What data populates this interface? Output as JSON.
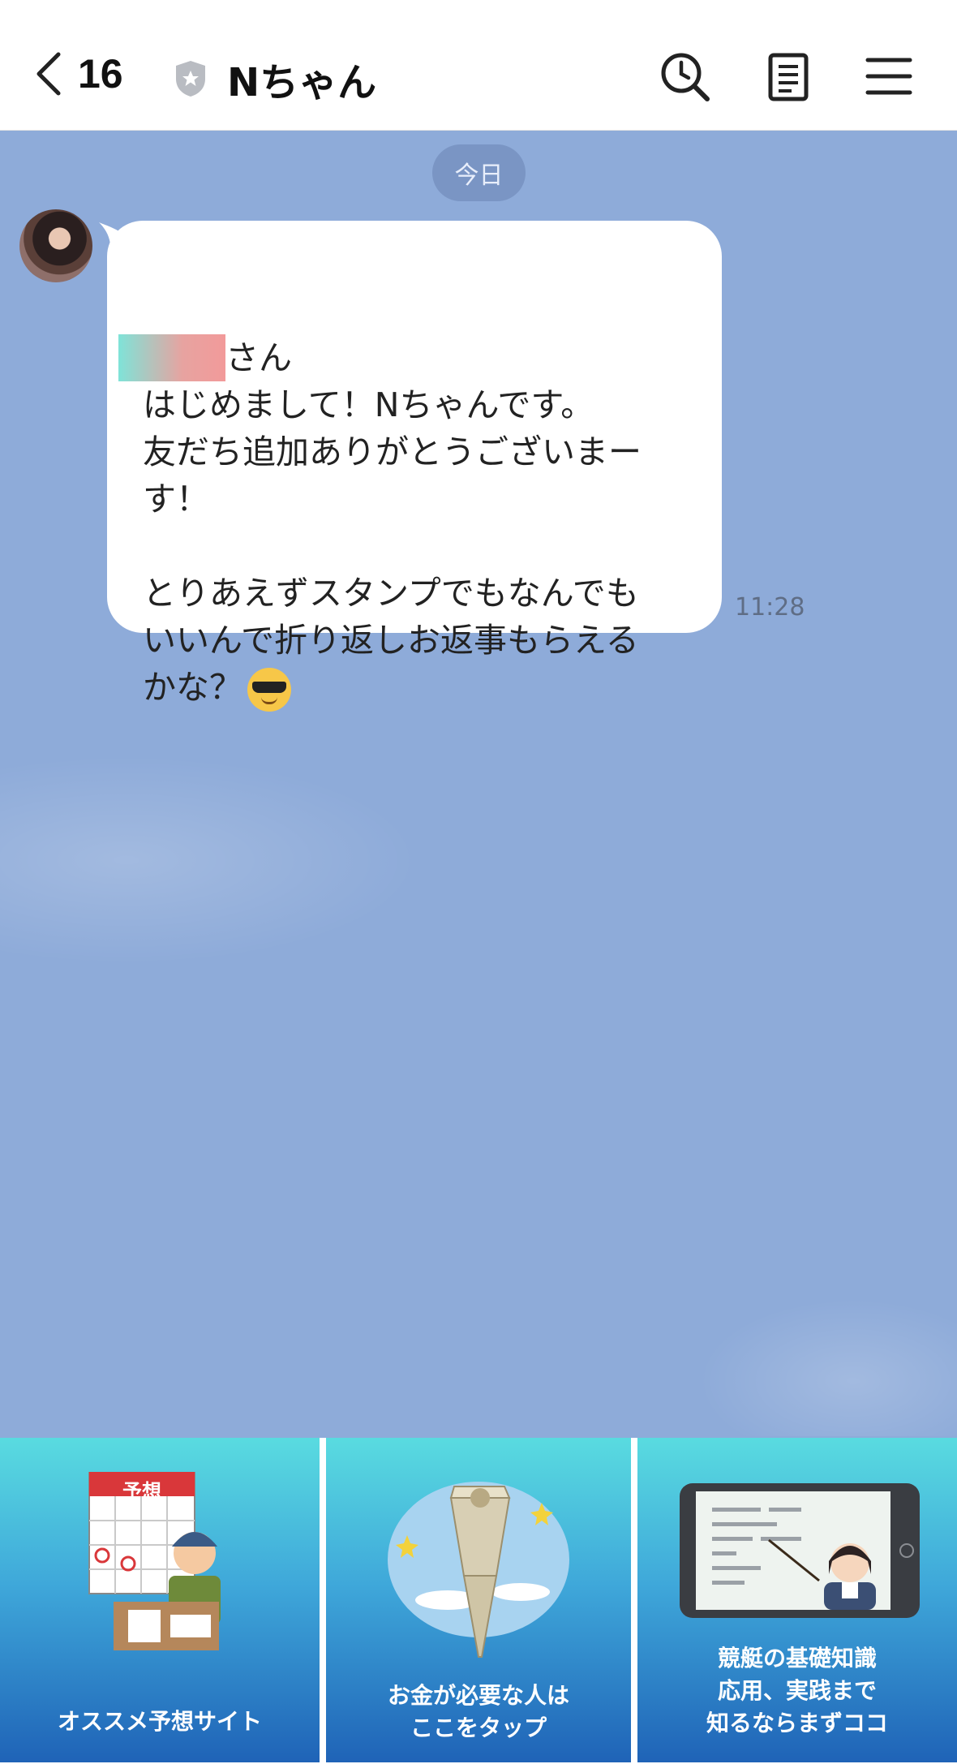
{
  "header": {
    "back_count": "16",
    "title": "Nちゃん",
    "icons": [
      "search-history-icon",
      "notes-icon",
      "menu-icon"
    ]
  },
  "chat": {
    "date": "今日",
    "message": {
      "suffix": "さん",
      "body": "はじめまして！Nちゃんです。\n友だち追加ありがとうございまー\nす！\n\nとりあえずスタンプでもなんでも\nいいんで折り返しお返事もらえる\nかな？",
      "emoji": "smiling-face-with-sunglasses",
      "time": "11:28"
    }
  },
  "rich_menu": {
    "items": [
      {
        "label": "オススメ予想サイト",
        "poster": "予想"
      },
      {
        "label": "お金が必要な人は\nここをタップ"
      },
      {
        "label": "競艇の基礎知識\n応用、実践まで\n知るならまずココ"
      }
    ]
  },
  "colors": {
    "chat_background": "#8eabd9",
    "tile_top": "#59dbe0",
    "tile_bottom": "#1f63b7"
  }
}
